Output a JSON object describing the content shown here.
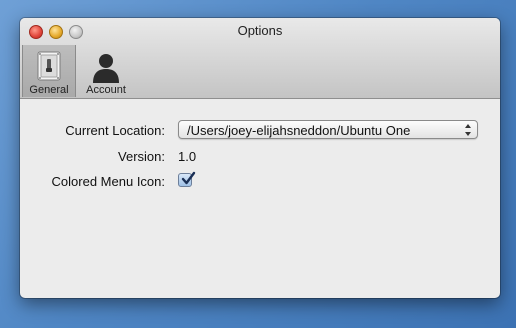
{
  "window": {
    "title": "Options"
  },
  "toolbar": {
    "tabs": [
      {
        "label": "General",
        "icon": "general-switch-icon",
        "selected": true
      },
      {
        "label": "Account",
        "icon": "account-person-icon",
        "selected": false
      }
    ]
  },
  "general": {
    "location_label": "Current Location:",
    "location_value": "/Users/joey-elijahsneddon/Ubuntu One",
    "version_label": "Version:",
    "version_value": "1.0",
    "colored_icon_label": "Colored Menu Icon:",
    "colored_icon_checked": true
  },
  "colors": {
    "accent": "#2f5ea8",
    "window_bg": "#ececec",
    "desktop": "#4f86c4"
  }
}
